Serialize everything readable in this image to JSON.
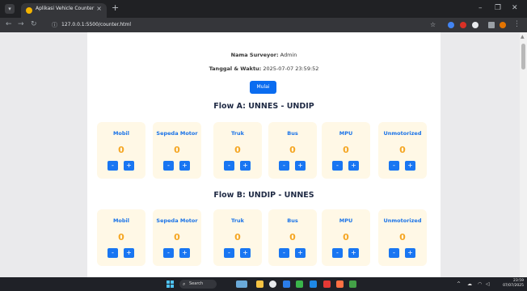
{
  "browser": {
    "tab_title": "Aplikasi Vehicle Counter",
    "tab_close": "×",
    "new_tab": "+",
    "url": "127.0.0.1:5500/counter.html",
    "controls": {
      "minimize": "–",
      "restore": "❐",
      "close": "✕"
    },
    "nav": {
      "back": "←",
      "forward": "→",
      "reload": "↻"
    }
  },
  "page": {
    "surveyor_label": "Nama Surveyor:",
    "surveyor_value": "Admin",
    "datetime_label": "Tanggal & Waktu:",
    "datetime_value": "2025-07-07 23:59:52",
    "start_label": "Mulai",
    "flows": [
      {
        "title": "Flow A: UNNES - UNDIP",
        "counters": [
          {
            "label": "Mobil",
            "count": "0"
          },
          {
            "label": "Sepeda Motor",
            "count": "0"
          },
          {
            "label": "Truk",
            "count": "0"
          },
          {
            "label": "Bus",
            "count": "0"
          },
          {
            "label": "MPU",
            "count": "0"
          },
          {
            "label": "Unmotorized",
            "count": "0"
          }
        ]
      },
      {
        "title": "Flow B: UNDIP - UNNES",
        "counters": [
          {
            "label": "Mobil",
            "count": "0"
          },
          {
            "label": "Sepeda Motor",
            "count": "0"
          },
          {
            "label": "Truk",
            "count": "0"
          },
          {
            "label": "Bus",
            "count": "0"
          },
          {
            "label": "MPU",
            "count": "0"
          },
          {
            "label": "Unmotorized",
            "count": "0"
          }
        ]
      }
    ],
    "decrement_label": "-",
    "increment_label": "+"
  },
  "taskbar": {
    "search_placeholder": "Search",
    "time": "23:59",
    "date": "07/07/2025"
  },
  "colors": {
    "accent": "#1976f2",
    "count": "#f5a623",
    "card_bg": "#fff8e6"
  }
}
